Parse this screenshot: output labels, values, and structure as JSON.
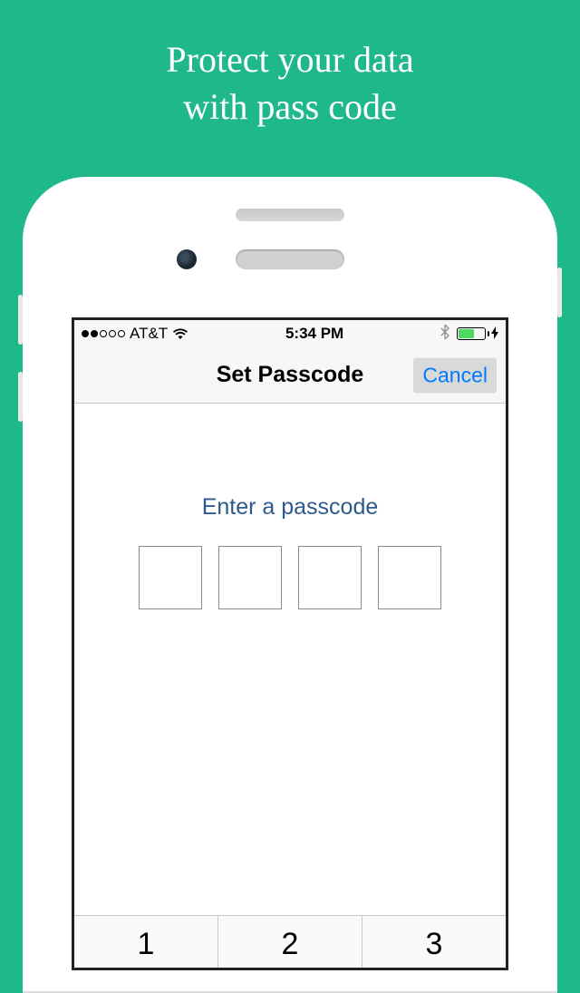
{
  "promo": {
    "line1": "Protect your data",
    "line2": "with pass code"
  },
  "status_bar": {
    "carrier": "AT&T",
    "time": "5:34 PM",
    "signal_strength": 2,
    "signal_total": 5
  },
  "nav": {
    "title": "Set Passcode",
    "cancel_label": "Cancel"
  },
  "content": {
    "prompt": "Enter a passcode"
  },
  "keypad": {
    "keys": [
      "1",
      "2",
      "3"
    ]
  }
}
